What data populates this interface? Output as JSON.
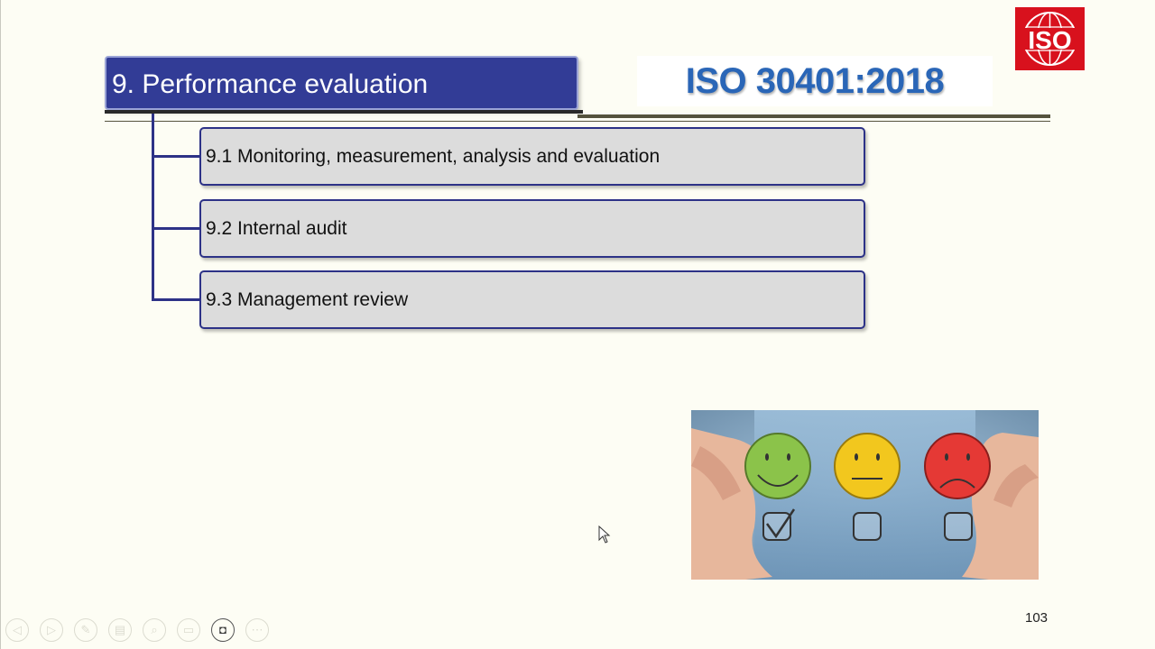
{
  "slide": {
    "title": "9. Performance evaluation",
    "standard_code": "ISO 30401:2018",
    "page_number": "103"
  },
  "logo": {
    "text": "ISO",
    "color": "#d8111d"
  },
  "tree": {
    "items": [
      {
        "label": "9.1 Monitoring, measurement, analysis and evaluation"
      },
      {
        "label": "9.2 Internal audit"
      },
      {
        "label": "9.3 Management review"
      }
    ]
  },
  "image": {
    "faces": [
      {
        "name": "happy-face-icon",
        "color": "#8bc34a",
        "checked": true
      },
      {
        "name": "neutral-face-icon",
        "color": "#f2c71e",
        "checked": false
      },
      {
        "name": "sad-face-icon",
        "color": "#e53935",
        "checked": false
      }
    ]
  },
  "toolbar": {
    "buttons": [
      {
        "icon": "previous-slide-icon",
        "glyph": "◁"
      },
      {
        "icon": "next-slide-icon",
        "glyph": "▷"
      },
      {
        "icon": "pen-icon",
        "glyph": "✎"
      },
      {
        "icon": "slides-icon",
        "glyph": "▤"
      },
      {
        "icon": "zoom-icon",
        "glyph": "⌕"
      },
      {
        "icon": "subtitles-icon",
        "glyph": "▭"
      },
      {
        "icon": "camera-icon",
        "glyph": "◘"
      },
      {
        "icon": "more-options-icon",
        "glyph": "⋯"
      }
    ]
  },
  "colors": {
    "title_bg": "#323c96",
    "code_text": "#2a66b7",
    "item_border": "#2d3287",
    "item_bg": "#dcdcdc"
  }
}
